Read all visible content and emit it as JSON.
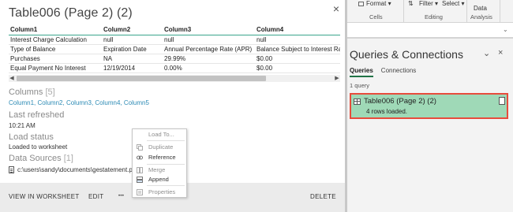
{
  "card": {
    "title": "Table006 (Page 2) (2)",
    "close": "×",
    "preview": {
      "headers": [
        "Column1",
        "Column2",
        "Column3",
        "Column4"
      ],
      "rows": [
        [
          "Interest Charge Calculation",
          "null",
          "null",
          "null"
        ],
        [
          "Type of Balance",
          "Expiration Date",
          "Annual Percentage Rate (APR)",
          "Balance Subject to Interest Rate"
        ],
        [
          "Purchases",
          "NA",
          "29.99%",
          "$0.00"
        ],
        [
          "Equal Payment No Interest",
          "12/19/2014",
          "0.00%",
          "$0.00"
        ]
      ]
    },
    "scroll": {
      "left_arrow": "◀",
      "right_arrow": "▶"
    },
    "columns_heading": "Columns",
    "columns_count": "[5]",
    "columns": [
      "Column1",
      "Column2",
      "Column3",
      "Column4",
      "Column5"
    ],
    "last_refreshed_heading": "Last refreshed",
    "last_refreshed_value": "10:21 AM",
    "load_status_heading": "Load status",
    "load_status_value": "Loaded to worksheet",
    "data_sources_heading": "Data Sources",
    "data_sources_count": "[1]",
    "data_source_path": "c:\\users\\sandy\\documents\\gestatement.pdf",
    "footer": {
      "view": "VIEW IN WORKSHEET",
      "edit": "EDIT",
      "more": "•••",
      "delete": "DELETE"
    }
  },
  "context_menu": {
    "load_to": "Load To...",
    "duplicate": "Duplicate",
    "reference": "Reference",
    "merge": "Merge",
    "append": "Append",
    "properties": "Properties"
  },
  "ribbon": {
    "format": "Format",
    "cells": "Cells",
    "filter": "Filter",
    "select": "Select",
    "editing": "Editing",
    "data": "Data",
    "analysis": "Analysis"
  },
  "queries_pane": {
    "title": "Queries & Connections",
    "tabs": [
      "Queries",
      "Connections"
    ],
    "count": "1 query",
    "item_name": "Table006 (Page 2) (2)",
    "item_status": "4 rows loaded.",
    "chevron": "⌄",
    "close": "×"
  },
  "colors": {
    "accent_green": "#217346",
    "query_item_bg": "#9fd9b7",
    "highlight_border": "#e74c3c",
    "link_blue": "#2d8bb5"
  }
}
